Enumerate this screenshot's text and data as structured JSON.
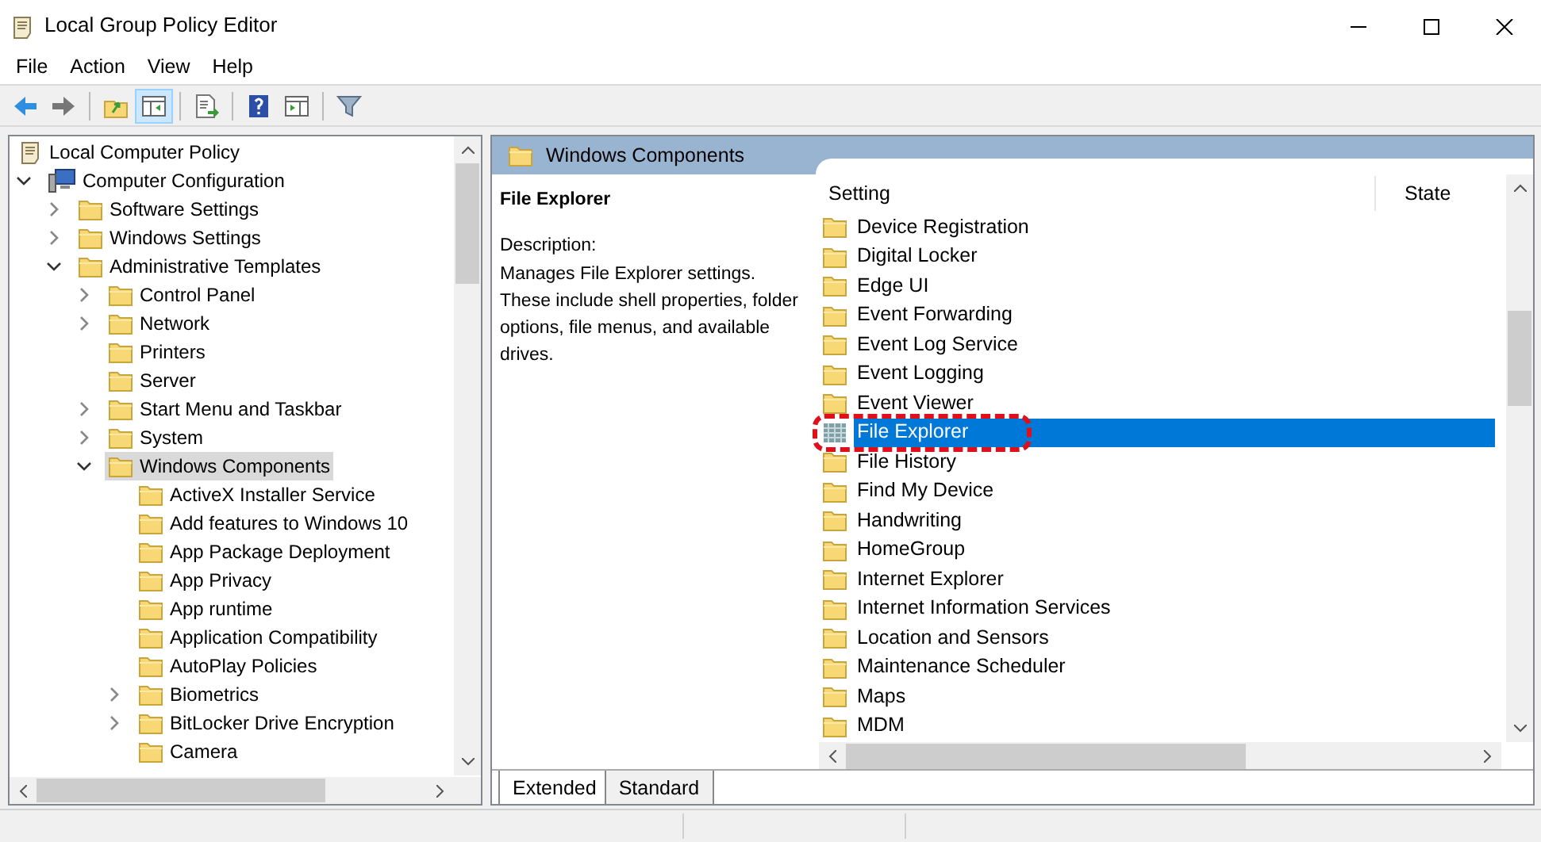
{
  "window": {
    "title": "Local Group Policy Editor"
  },
  "menu": [
    "File",
    "Action",
    "View",
    "Help"
  ],
  "toolbar": [
    {
      "kind": "back",
      "pressed": false
    },
    {
      "kind": "forward",
      "pressed": false
    },
    {
      "kind": "up",
      "pressed": false
    },
    {
      "kind": "tree",
      "pressed": true
    },
    {
      "kind": "export",
      "pressed": false
    },
    {
      "kind": "help",
      "pressed": false
    },
    {
      "kind": "pane",
      "pressed": false
    },
    {
      "kind": "filter",
      "pressed": false
    }
  ],
  "tree": [
    {
      "label": "Local Computer Policy",
      "kind": "policy",
      "selected": false,
      "children": [
        {
          "label": "Computer Configuration",
          "kind": "computer",
          "expanded": true,
          "selected": false,
          "children": [
            {
              "label": "Software Settings",
              "expanded": false,
              "selected": false
            },
            {
              "label": "Windows Settings",
              "expanded": false,
              "selected": false
            },
            {
              "label": "Administrative Templates",
              "expanded": true,
              "selected": false,
              "children": [
                {
                  "label": "Control Panel",
                  "expanded": false,
                  "selected": false
                },
                {
                  "label": "Network",
                  "expanded": false,
                  "selected": false
                },
                {
                  "label": "Printers",
                  "selected": false
                },
                {
                  "label": "Server",
                  "selected": false
                },
                {
                  "label": "Start Menu and Taskbar",
                  "expanded": false,
                  "selected": false
                },
                {
                  "label": "System",
                  "expanded": false,
                  "selected": false
                },
                {
                  "label": "Windows Components",
                  "expanded": true,
                  "selected": true,
                  "children": [
                    {
                      "label": "ActiveX Installer Service",
                      "selected": false
                    },
                    {
                      "label": "Add features to Windows 10",
                      "selected": false
                    },
                    {
                      "label": "App Package Deployment",
                      "selected": false
                    },
                    {
                      "label": "App Privacy",
                      "selected": false
                    },
                    {
                      "label": "App runtime",
                      "selected": false
                    },
                    {
                      "label": "Application Compatibility",
                      "selected": false
                    },
                    {
                      "label": "AutoPlay Policies",
                      "selected": false
                    },
                    {
                      "label": "Biometrics",
                      "expanded": false,
                      "selected": false
                    },
                    {
                      "label": "BitLocker Drive Encryption",
                      "expanded": false,
                      "selected": false
                    },
                    {
                      "label": "Camera",
                      "selected": false
                    }
                  ]
                }
              ]
            }
          ]
        }
      ]
    }
  ],
  "details": {
    "heading": "Windows Components",
    "title": "File Explorer",
    "description_label": "Description:",
    "description": "Manages File Explorer settings. These include shell properties, folder options, file menus, and available drives."
  },
  "columns": [
    "Setting",
    "State"
  ],
  "settings": [
    {
      "label": "Device Registration",
      "selected": false,
      "circled": false
    },
    {
      "label": "Digital Locker",
      "selected": false,
      "circled": false
    },
    {
      "label": "Edge UI",
      "selected": false,
      "circled": false
    },
    {
      "label": "Event Forwarding",
      "selected": false,
      "circled": false
    },
    {
      "label": "Event Log Service",
      "selected": false,
      "circled": false
    },
    {
      "label": "Event Logging",
      "selected": false,
      "circled": false
    },
    {
      "label": "Event Viewer",
      "selected": false,
      "circled": false
    },
    {
      "label": "File Explorer",
      "selected": true,
      "circled": true
    },
    {
      "label": "File History",
      "selected": false,
      "circled": false
    },
    {
      "label": "Find My Device",
      "selected": false,
      "circled": false
    },
    {
      "label": "Handwriting",
      "selected": false,
      "circled": false
    },
    {
      "label": "HomeGroup",
      "selected": false,
      "circled": false
    },
    {
      "label": "Internet Explorer",
      "selected": false,
      "circled": false
    },
    {
      "label": "Internet Information Services",
      "selected": false,
      "circled": false
    },
    {
      "label": "Location and Sensors",
      "selected": false,
      "circled": false
    },
    {
      "label": "Maintenance Scheduler",
      "selected": false,
      "circled": false
    },
    {
      "label": "Maps",
      "selected": false,
      "circled": false
    },
    {
      "label": "MDM",
      "selected": false,
      "circled": false
    }
  ],
  "tabs": [
    {
      "label": "Extended",
      "selected": true
    },
    {
      "label": "Standard",
      "selected": false
    }
  ]
}
